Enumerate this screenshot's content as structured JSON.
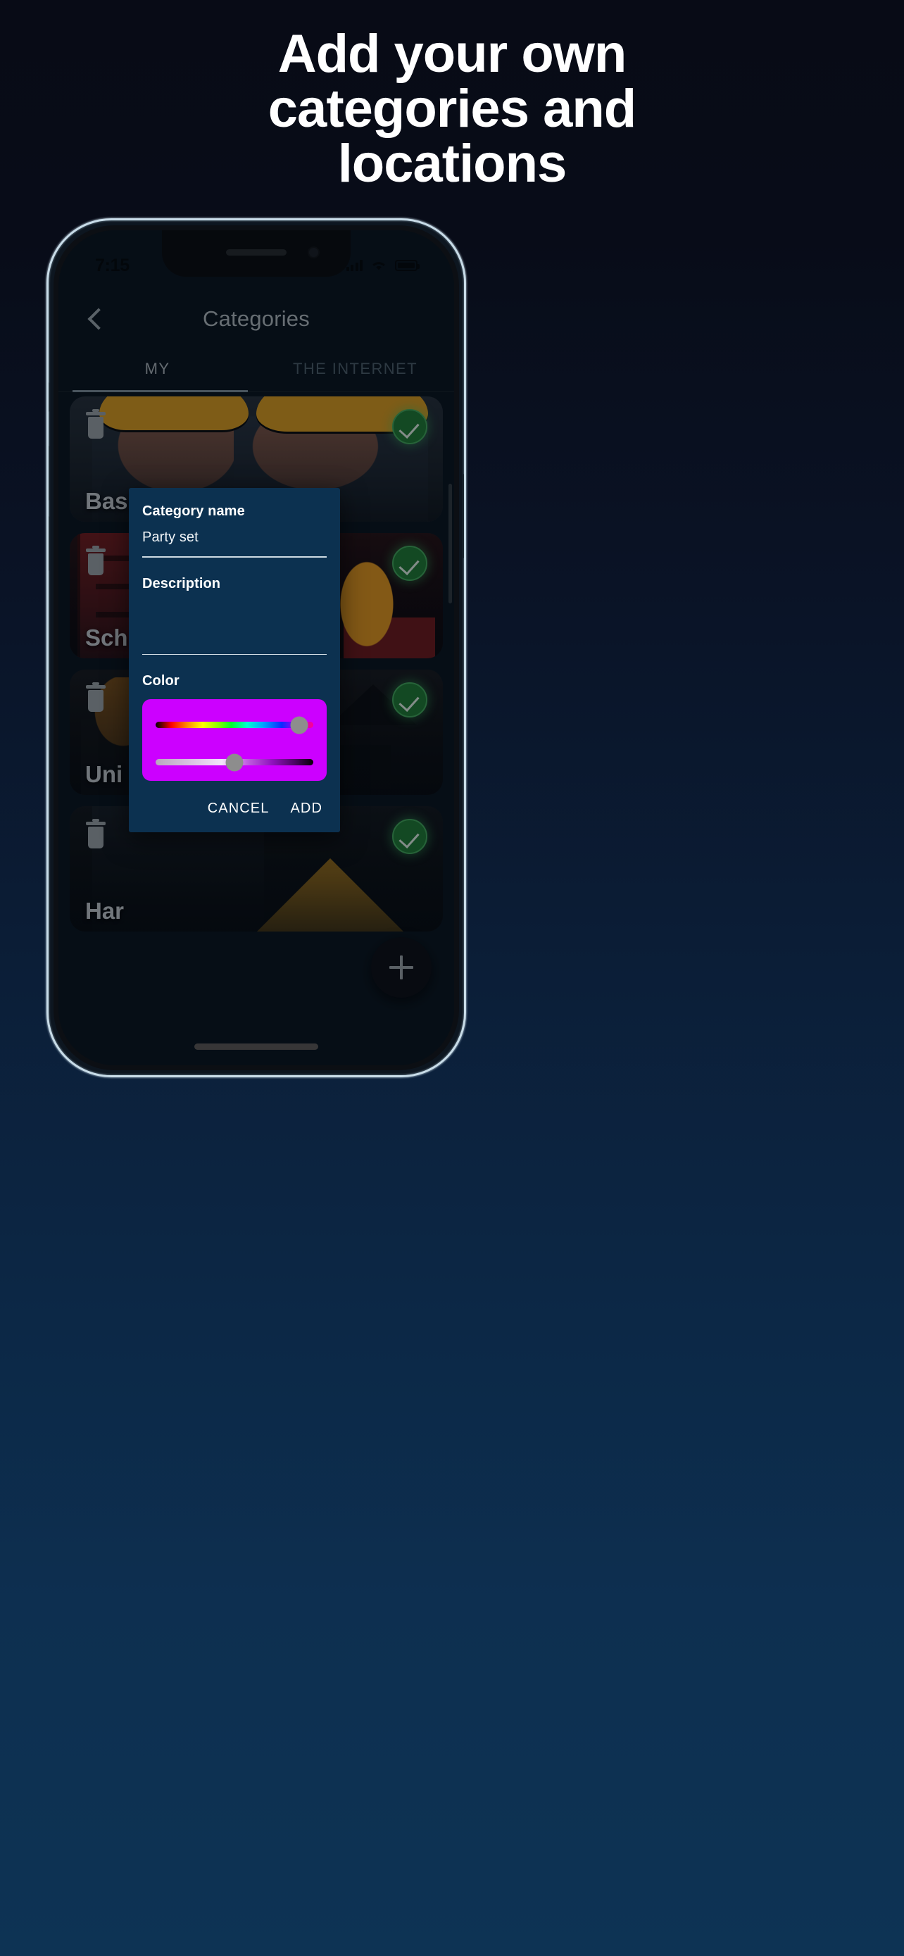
{
  "promo": {
    "headline_lines": [
      "Add your own",
      "categories and",
      "locations"
    ],
    "background_top_color": "#080b16",
    "background_bottom_color": "#0d3354"
  },
  "phone": {
    "status_bar": {
      "time": "7:15",
      "icons": [
        "signal-icon",
        "wifi-icon",
        "battery-icon"
      ]
    },
    "home_indicator": true
  },
  "app": {
    "header": {
      "back_icon": "chevron-left-icon",
      "title": "Categories"
    },
    "tabs": [
      {
        "label": "MY",
        "active": true
      },
      {
        "label": "THE INTERNET",
        "active": false
      }
    ],
    "cards": [
      {
        "label": "Basic set",
        "delete_icon": "trash-icon",
        "selected_icon": "check-circle-icon",
        "selected": true
      },
      {
        "label": "Sch",
        "delete_icon": "trash-icon",
        "selected_icon": "check-circle-icon",
        "selected": true
      },
      {
        "label": "Uni",
        "delete_icon": "trash-icon",
        "selected_icon": "check-circle-icon",
        "selected": true
      },
      {
        "label": "Har",
        "delete_icon": "trash-icon",
        "selected_icon": "check-circle-icon",
        "selected": true
      }
    ],
    "fab": {
      "icon": "plus-icon",
      "label": "+"
    }
  },
  "dialog": {
    "name_label": "Category name",
    "name_value": "Party set",
    "name_placeholder": "",
    "description_label": "Description",
    "description_value": "",
    "description_placeholder": "",
    "color_label": "Color",
    "color_value": "#CC00FF",
    "hue_position_percent": 85,
    "lightness_position_percent": 50,
    "cancel_label": "CANCEL",
    "add_label": "ADD"
  }
}
